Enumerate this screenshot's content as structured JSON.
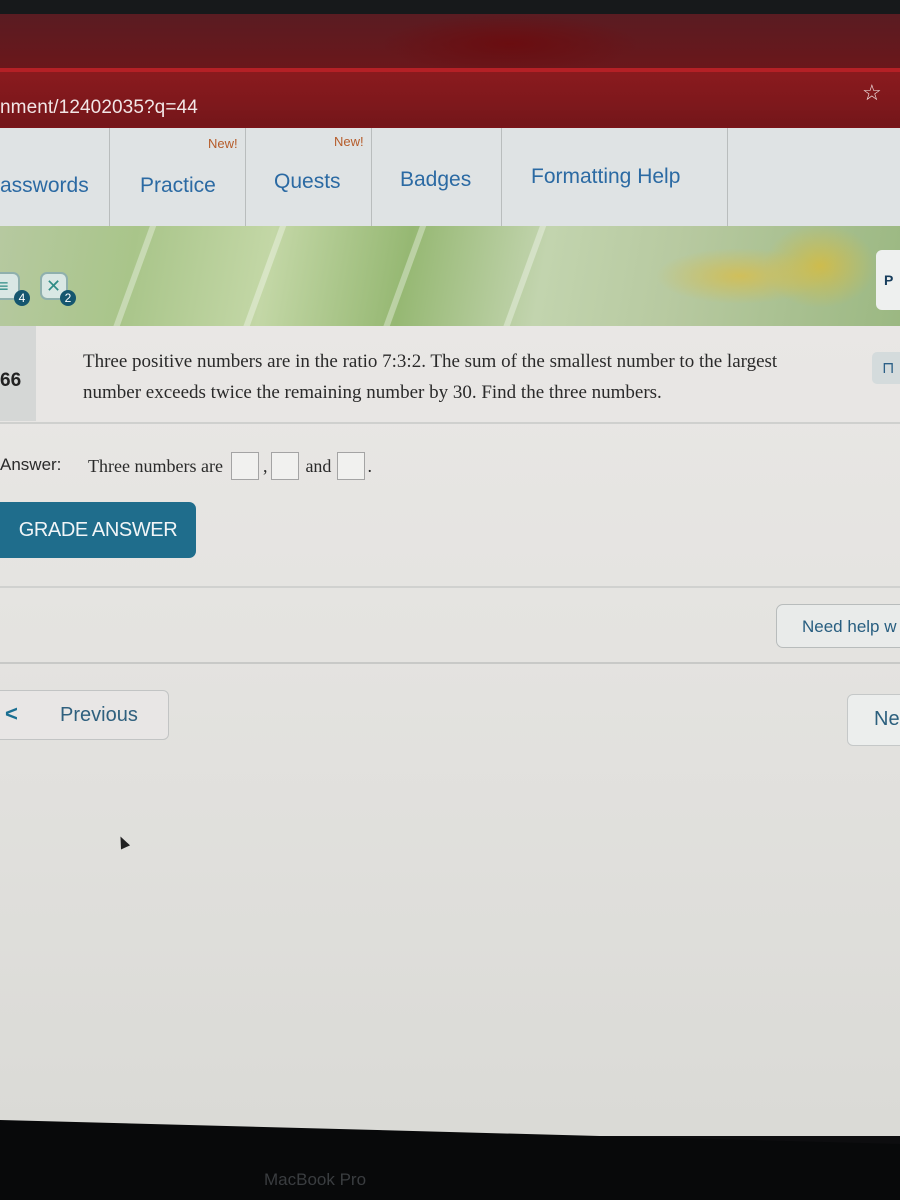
{
  "browser": {
    "url_fragment": "nment/12402035?q=44",
    "bookmark_icon": "star-icon"
  },
  "nav": {
    "items": [
      {
        "label": "asswords",
        "new": ""
      },
      {
        "label": "Practice",
        "new": "New!"
      },
      {
        "label": "Quests",
        "new": "New!"
      },
      {
        "label": "Badges",
        "new": ""
      },
      {
        "label": "Formatting Help",
        "new": ""
      }
    ]
  },
  "badges": [
    {
      "icon": "stack-icon",
      "count": "4"
    },
    {
      "icon": "tools-icon",
      "count": "2"
    }
  ],
  "question": {
    "number": "66",
    "text": "Three positive numbers are in the ratio 7:3:2. The sum of the smallest number to the largest number exceeds twice the remaining number by 30. Find the three numbers."
  },
  "answer": {
    "label": "Answer:",
    "prefix": "Three numbers are",
    "comma": ",",
    "and": "and",
    "period": ".",
    "values": [
      "",
      "",
      ""
    ]
  },
  "buttons": {
    "grade": "GRADE ANSWER",
    "help": "Need help w",
    "previous": "Previous",
    "next": "Ne"
  },
  "colors": {
    "accent": "#1f6d8c",
    "link": "#2b6aa3",
    "browser_bar": "#7a151a"
  },
  "device": {
    "brand": "MacBook Pro"
  }
}
